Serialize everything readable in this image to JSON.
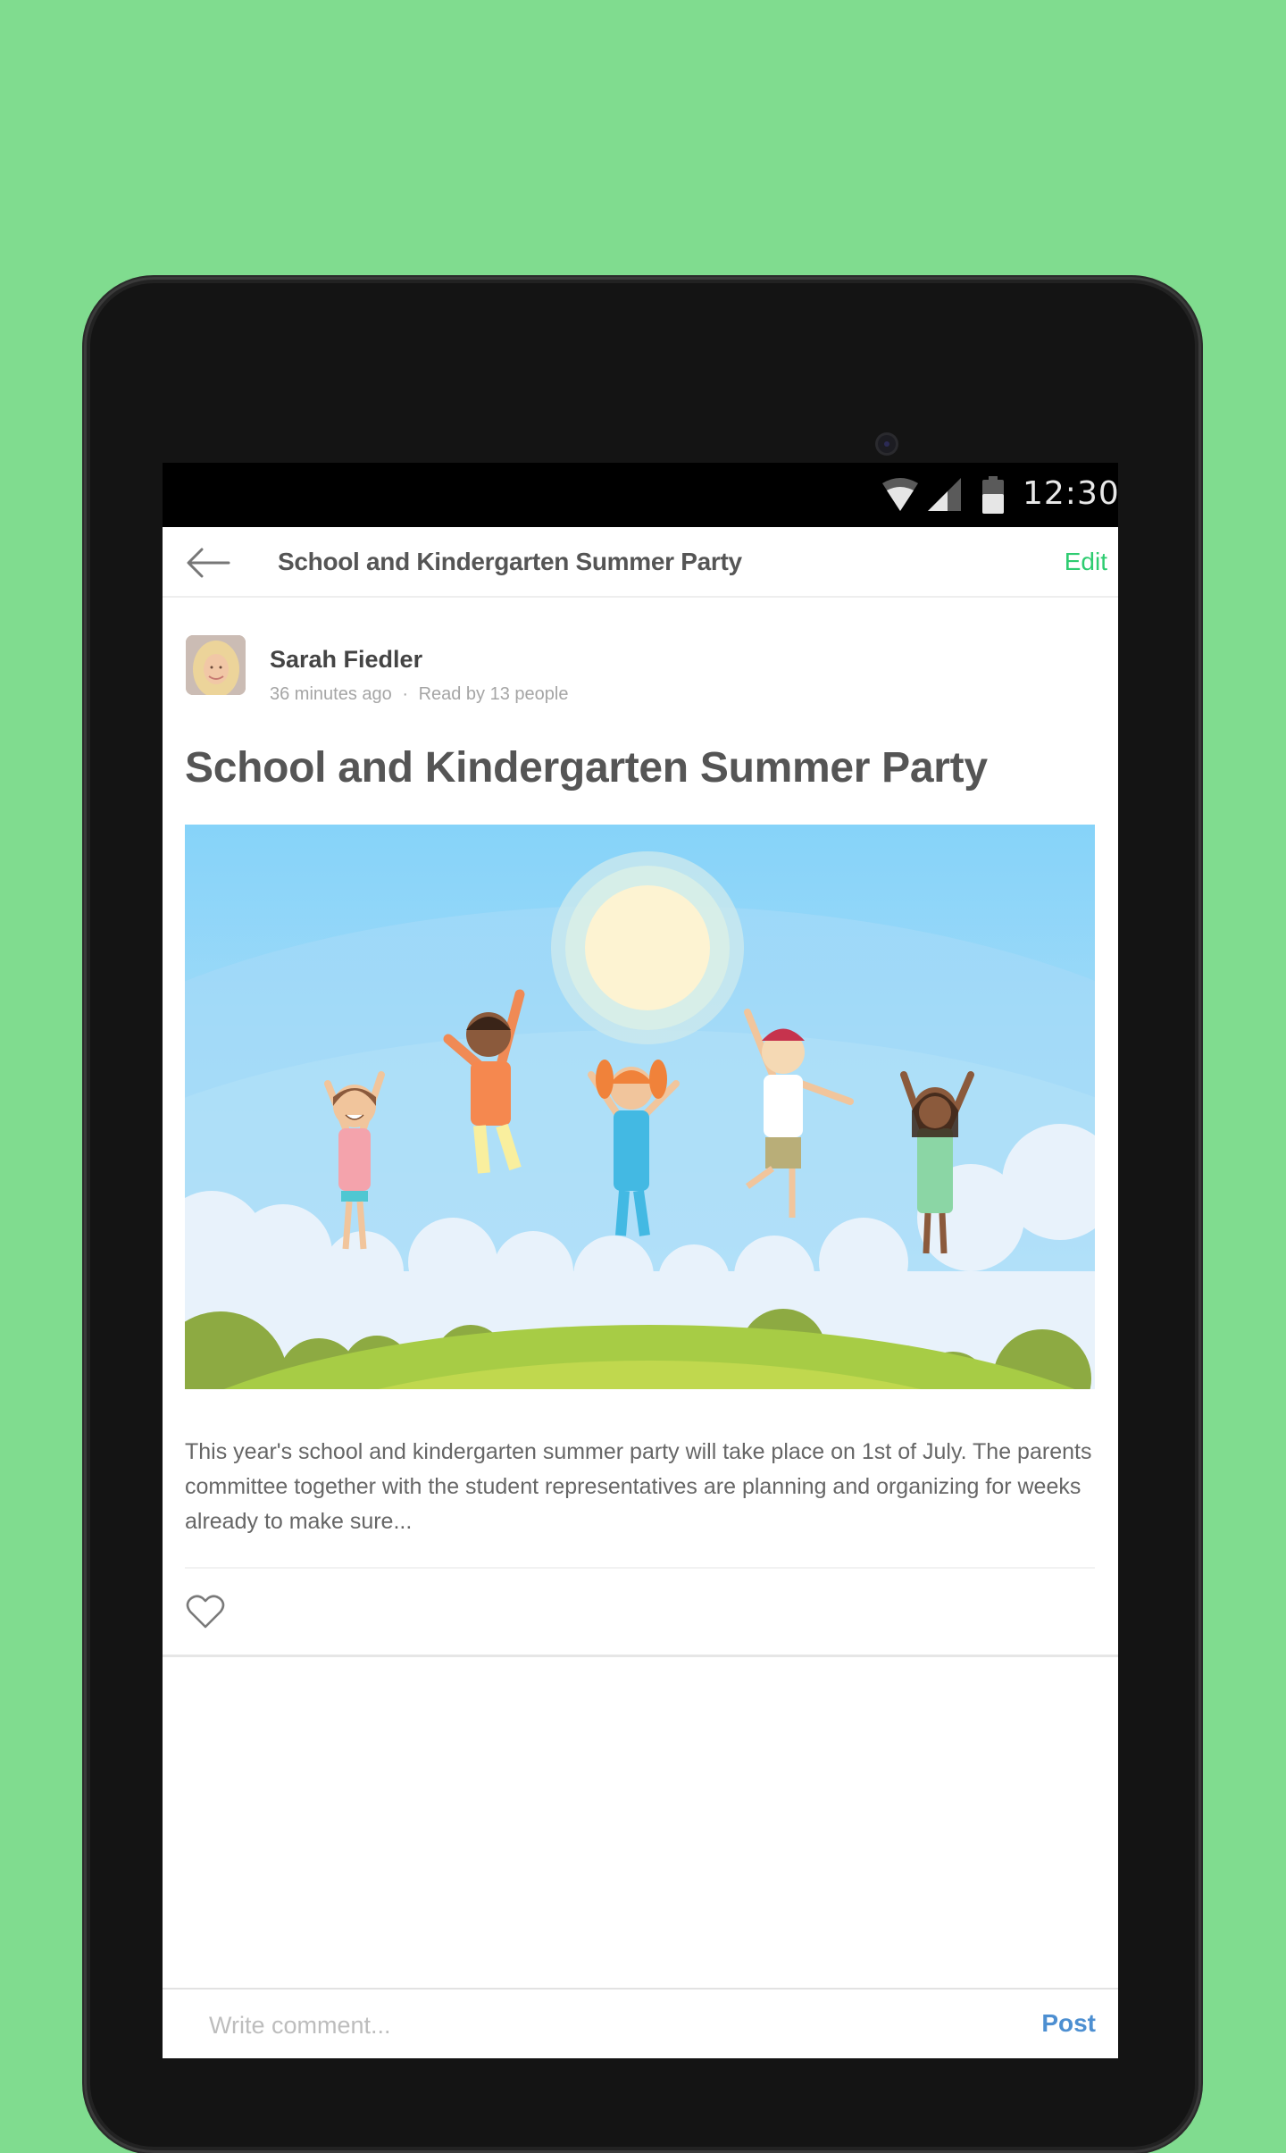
{
  "status_bar": {
    "time": "12:30",
    "icons": [
      "wifi-icon",
      "cell-signal-icon",
      "battery-icon"
    ]
  },
  "app_bar": {
    "back_icon": "arrow-left-icon",
    "title": "School and Kindergarten Summer Party",
    "edit_label": "Edit"
  },
  "post": {
    "author": {
      "name": "Sarah Fiedler",
      "avatar": "author-photo",
      "time_ago": "36 minutes ago",
      "separator": "·",
      "read_by": "Read by 13 people"
    },
    "title": "School and Kindergarten Summer Party",
    "image": "illustration of five children jumping under a sun over a green hill",
    "body": "This year's school and kindergarten summer party will take place on 1st of July. The parents committee together with the student representatives are planning and organizing for weeks already to make sure...",
    "like_icon": "heart-outline-icon"
  },
  "comment": {
    "placeholder": "Write comment...",
    "value": "",
    "post_label": "Post"
  },
  "colors": {
    "background": "#80dc8f",
    "accent_edit": "#2ecc71",
    "accent_post": "#4d8fd1",
    "text_primary": "#555555",
    "text_secondary": "#a5a5a5"
  }
}
